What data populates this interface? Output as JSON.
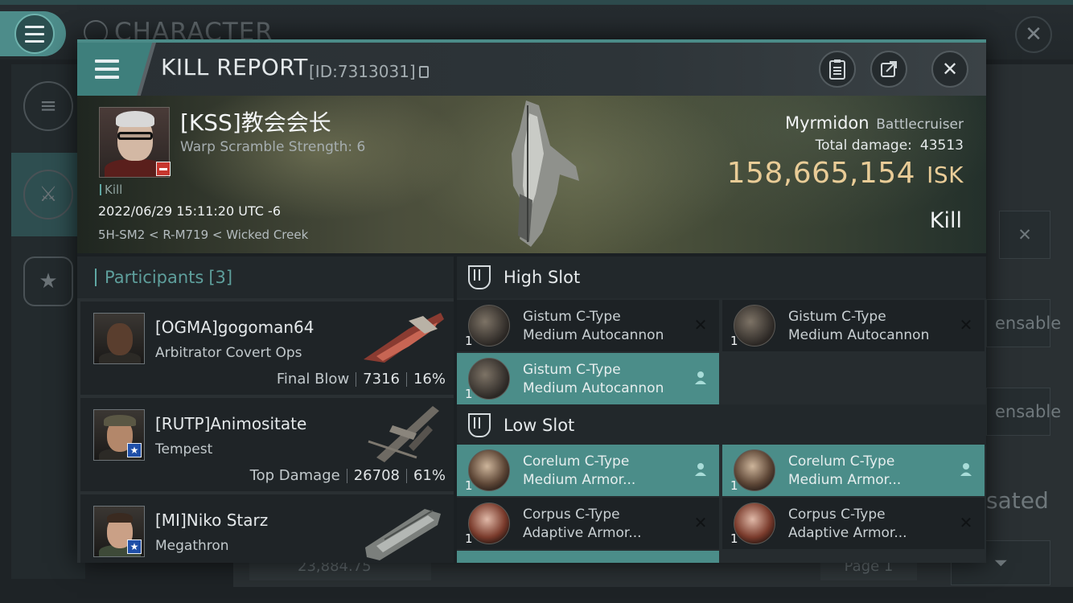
{
  "background": {
    "title": "CHARACTER",
    "right_buttons": [
      "ensable",
      "ensable"
    ],
    "right_text": "sated",
    "bottom_value": "23,884.75",
    "page_label": "Page 1"
  },
  "report": {
    "title": "KILL REPORT",
    "id_label": "[ID:7313031]"
  },
  "victim": {
    "name": "[KSS]教会会长",
    "scramble": "Warp Scramble Strength: 6",
    "tag": "Kill",
    "datetime": "2022/06/29 15:11:20 UTC -6",
    "location": "5H-SM2 < R-M719 < Wicked Creek",
    "ship_name": "Myrmidon",
    "ship_class": "Battlecruiser",
    "total_damage_label": "Total damage:",
    "total_damage": "43513",
    "isk_value": "158,665,154",
    "isk_unit": "ISK",
    "result": "Kill"
  },
  "participants": {
    "header": "Participants",
    "count": "[3]",
    "rows": [
      {
        "name": "[OGMA]gogoman64",
        "ship": "Arbitrator Covert Ops",
        "tag": "Final Blow",
        "damage": "7316",
        "percent": "16%"
      },
      {
        "name": "[RUTP]Animositate",
        "ship": "Tempest",
        "tag": "Top Damage",
        "damage": "26708",
        "percent": "61%"
      },
      {
        "name": "[MI]Niko Starz",
        "ship": "Megathron",
        "tag": "",
        "damage": "",
        "percent": ""
      }
    ]
  },
  "fitting": {
    "high_slot_title": "High Slot",
    "low_slot_title": "Low Slot",
    "high": [
      {
        "qty": "1",
        "line1": "Gistum C-Type",
        "line2": "Medium Autocannon",
        "state": "destroyed"
      },
      {
        "qty": "1",
        "line1": "Gistum C-Type",
        "line2": "Medium Autocannon",
        "state": "destroyed"
      },
      {
        "qty": "1",
        "line1": "Gistum C-Type",
        "line2": "Medium Autocannon",
        "state": "dropped"
      }
    ],
    "low": [
      {
        "qty": "1",
        "line1": "Corelum C-Type",
        "line2": "Medium Armor...",
        "state": "dropped"
      },
      {
        "qty": "1",
        "line1": "Corelum C-Type",
        "line2": "Medium Armor...",
        "state": "dropped"
      },
      {
        "qty": "1",
        "line1": "Corpus C-Type",
        "line2": "Adaptive Armor...",
        "state": "destroyed"
      },
      {
        "qty": "1",
        "line1": "Corpus C-Type",
        "line2": "Adaptive Armor...",
        "state": "destroyed"
      }
    ]
  },
  "colors": {
    "accent": "#4b8d89",
    "isk_gold": "#e9cc97",
    "header_teal": "#3e7f7c"
  }
}
